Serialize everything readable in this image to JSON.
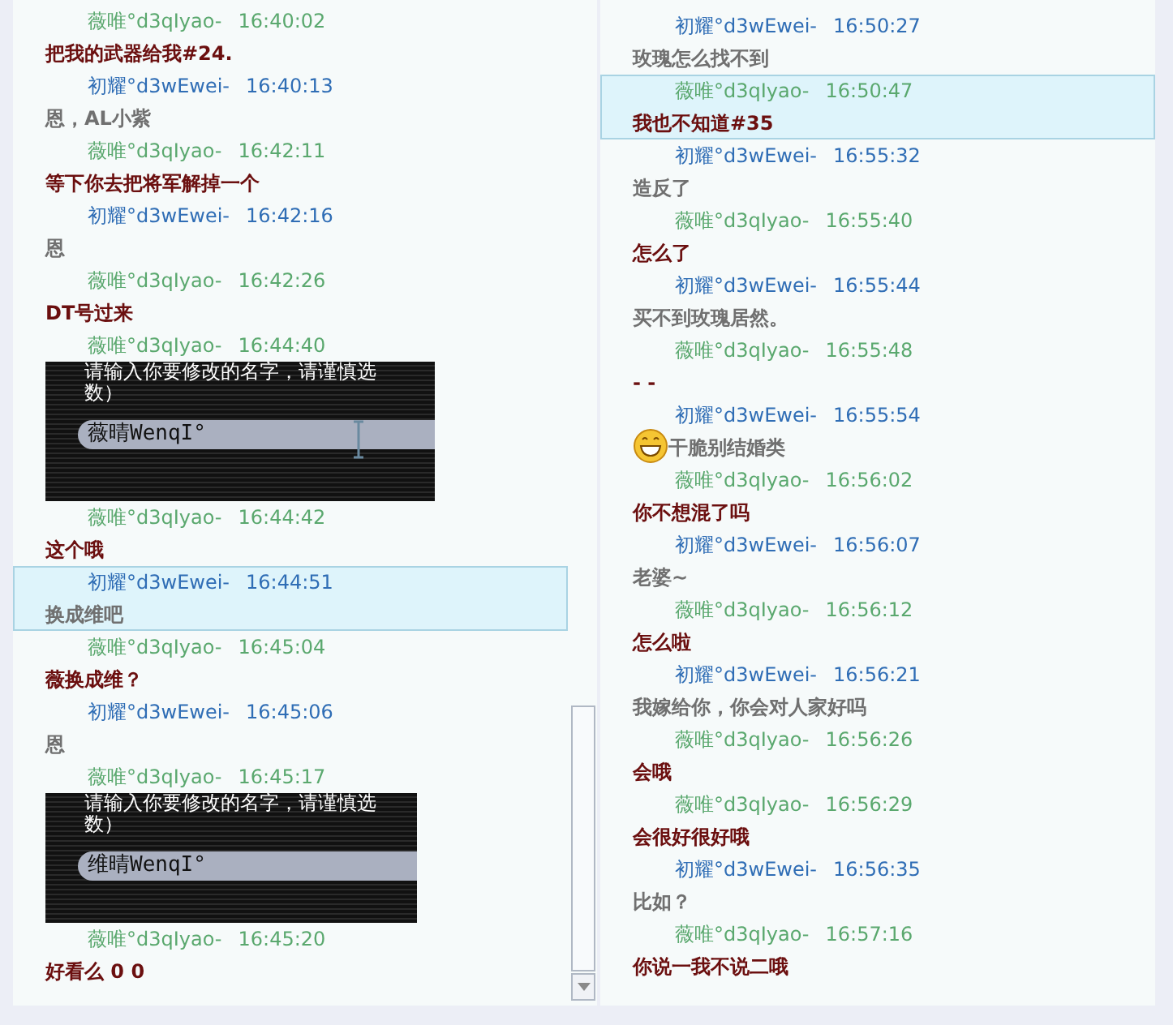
{
  "panels": [
    {
      "scrollbar": true,
      "messages": [
        {
          "kind": "self",
          "sender": "薇唯°d3qIyao-",
          "time": "16:40:02",
          "text": "把我的武器给我#24.",
          "selected": false
        },
        {
          "kind": "other",
          "sender": "初耀°d3wEwei-",
          "time": "16:40:13",
          "text": "恩，AL小紫",
          "selected": false
        },
        {
          "kind": "self",
          "sender": "薇唯°d3qIyao-",
          "time": "16:42:11",
          "text": "等下你去把将军解掉一个",
          "selected": false
        },
        {
          "kind": "other",
          "sender": "初耀°d3wEwei-",
          "time": "16:42:16",
          "text": "恩",
          "selected": false
        },
        {
          "kind": "self",
          "sender": "薇唯°d3qIyao-",
          "time": "16:42:26",
          "text": "DT号过来",
          "selected": false
        },
        {
          "kind": "self",
          "sender": "薇唯°d3qIyao-",
          "time": "16:44:40",
          "selected": false,
          "screenshot": {
            "prompt": "请输入你要修改的名字，请谨慎选",
            "prompt_end": "数）",
            "value": "薇晴WenqI°",
            "cursor": true
          }
        },
        {
          "kind": "self",
          "sender": "薇唯°d3qIyao-",
          "time": "16:44:42",
          "text": "这个哦",
          "selected": false
        },
        {
          "kind": "other",
          "sender": "初耀°d3wEwei-",
          "time": "16:44:51",
          "text": "换成维吧",
          "selected": true
        },
        {
          "kind": "self",
          "sender": "薇唯°d3qIyao-",
          "time": "16:45:04",
          "text": "薇换成维？",
          "selected": false
        },
        {
          "kind": "other",
          "sender": "初耀°d3wEwei-",
          "time": "16:45:06",
          "text": "恩",
          "selected": false
        },
        {
          "kind": "self",
          "sender": "薇唯°d3qIyao-",
          "time": "16:45:17",
          "selected": false,
          "screenshot": {
            "prompt": "请输入你要修改的名字，请谨慎选",
            "prompt_end": "数）",
            "value": "维晴WenqI°"
          }
        },
        {
          "kind": "self",
          "sender": "薇唯°d3qIyao-",
          "time": "16:45:20",
          "text": "好看么 0 0",
          "selected": false
        }
      ]
    },
    {
      "messages": [
        {
          "kind": "other",
          "sender": "初耀°d3wEwei-",
          "time": "16:50:27",
          "text": "玫瑰怎么找不到",
          "selected": false
        },
        {
          "kind": "self",
          "sender": "薇唯°d3qIyao-",
          "time": "16:50:47",
          "text": "我也不知道#35",
          "selected": true
        },
        {
          "kind": "other",
          "sender": "初耀°d3wEwei-",
          "time": "16:55:32",
          "text": "造反了",
          "selected": false
        },
        {
          "kind": "self",
          "sender": "薇唯°d3qIyao-",
          "time": "16:55:40",
          "text": "怎么了",
          "selected": false
        },
        {
          "kind": "other",
          "sender": "初耀°d3wEwei-",
          "time": "16:55:44",
          "text": "买不到玫瑰居然。",
          "selected": false
        },
        {
          "kind": "self",
          "sender": "薇唯°d3qIyao-",
          "time": "16:55:48",
          "text": "- -",
          "selected": false
        },
        {
          "kind": "other",
          "sender": "初耀°d3wEwei-",
          "time": "16:55:54",
          "text": "干脆别结婚类",
          "emoji": true,
          "selected": false
        },
        {
          "kind": "self",
          "sender": "薇唯°d3qIyao-",
          "time": "16:56:02",
          "text": "你不想混了吗",
          "selected": false
        },
        {
          "kind": "other",
          "sender": "初耀°d3wEwei-",
          "time": "16:56:07",
          "text": "老婆~",
          "selected": false
        },
        {
          "kind": "self",
          "sender": "薇唯°d3qIyao-",
          "time": "16:56:12",
          "text": "怎么啦",
          "selected": false
        },
        {
          "kind": "other",
          "sender": "初耀°d3wEwei-",
          "time": "16:56:21",
          "text": "我嫁给你，你会对人家好吗",
          "selected": false
        },
        {
          "kind": "self",
          "sender": "薇唯°d3qIyao-",
          "time": "16:56:26",
          "text": "会哦",
          "selected": false
        },
        {
          "kind": "self",
          "sender": "薇唯°d3qIyao-",
          "time": "16:56:29",
          "text": "会很好很好哦",
          "selected": false
        },
        {
          "kind": "other",
          "sender": "初耀°d3wEwei-",
          "time": "16:56:35",
          "text": "比如？",
          "selected": false
        },
        {
          "kind": "self",
          "sender": "薇唯°d3qIyao-",
          "time": "16:57:16",
          "text": "你说一我不说二哦",
          "selected": false
        }
      ]
    }
  ]
}
